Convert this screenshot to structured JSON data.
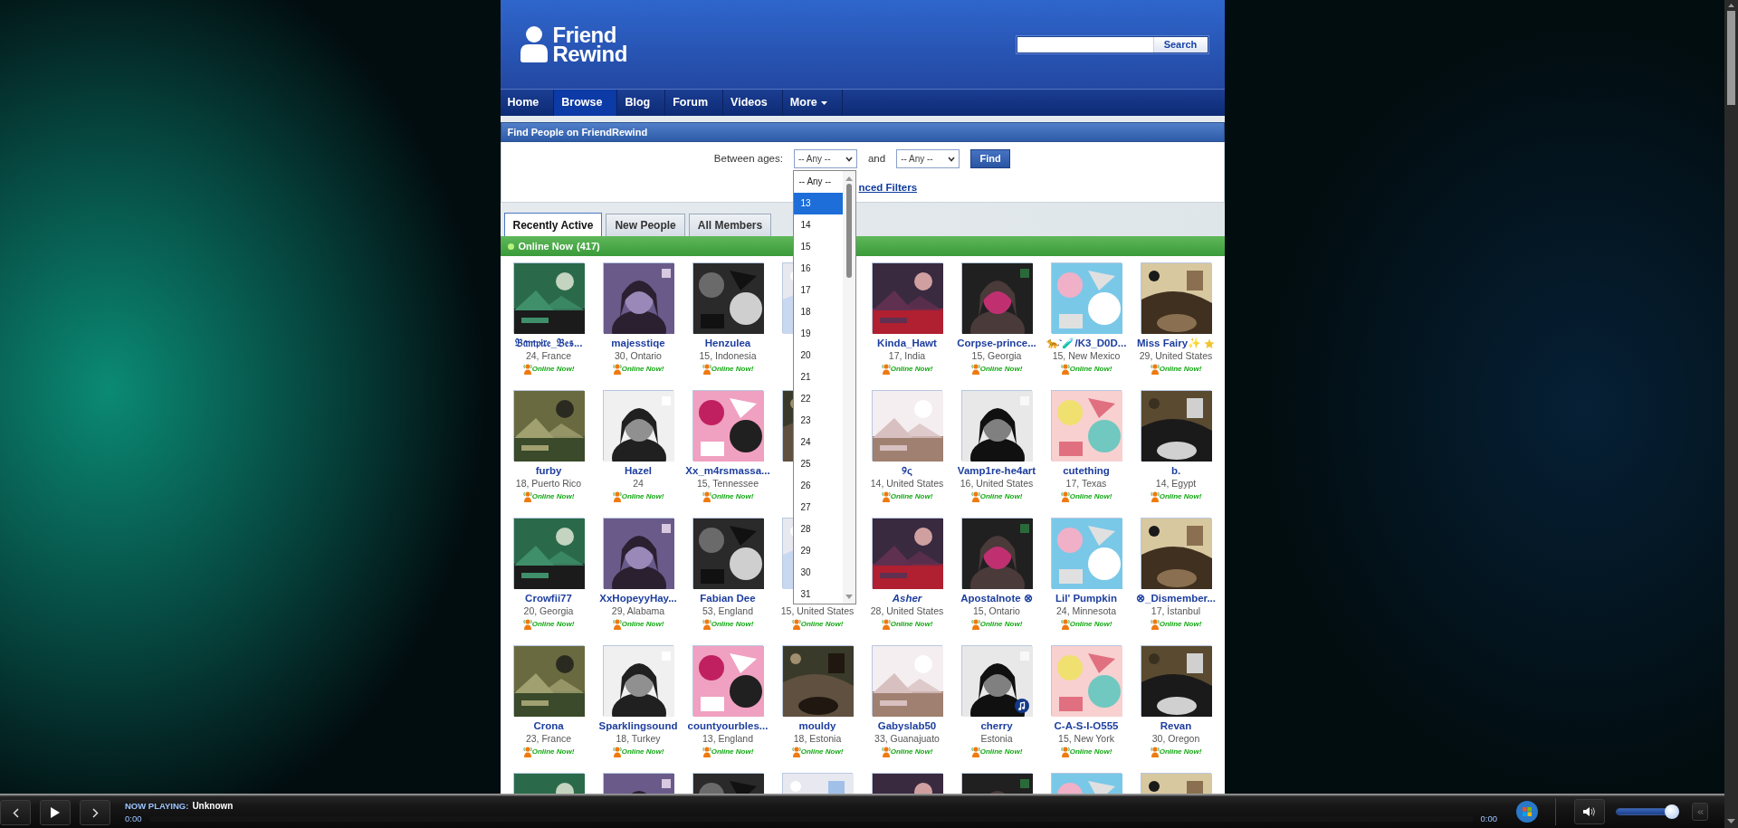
{
  "header": {
    "logo_top": "Friend",
    "logo_bottom": "Rewind",
    "search_button": "Search"
  },
  "nav": [
    {
      "label": "Home",
      "selected": false,
      "menu": false
    },
    {
      "label": "Browse",
      "selected": true,
      "menu": false
    },
    {
      "label": "Blog",
      "selected": false,
      "menu": false
    },
    {
      "label": "Forum",
      "selected": false,
      "menu": false
    },
    {
      "label": "Videos",
      "selected": false,
      "menu": false
    },
    {
      "label": "More",
      "selected": false,
      "menu": true
    }
  ],
  "finder": {
    "title": "Find People on FriendRewind",
    "label": "Between ages:",
    "min_value": "-- Any --",
    "joiner": "and",
    "max_value": "-- Any --",
    "button": "Find",
    "link": "nced Filters"
  },
  "age_dropdown": {
    "options": [
      {
        "label": "-- Any --",
        "selected": false
      },
      {
        "label": "13",
        "selected": true
      },
      {
        "label": "14",
        "selected": false
      },
      {
        "label": "15",
        "selected": false
      },
      {
        "label": "16",
        "selected": false
      },
      {
        "label": "17",
        "selected": false
      },
      {
        "label": "18",
        "selected": false
      },
      {
        "label": "19",
        "selected": false
      },
      {
        "label": "20",
        "selected": false
      },
      {
        "label": "21",
        "selected": false
      },
      {
        "label": "22",
        "selected": false
      },
      {
        "label": "23",
        "selected": false
      },
      {
        "label": "24",
        "selected": false
      },
      {
        "label": "25",
        "selected": false
      },
      {
        "label": "26",
        "selected": false
      },
      {
        "label": "27",
        "selected": false
      },
      {
        "label": "28",
        "selected": false
      },
      {
        "label": "29",
        "selected": false
      },
      {
        "label": "30",
        "selected": false
      },
      {
        "label": "31",
        "selected": false
      }
    ]
  },
  "tabs": [
    {
      "label": "Recently Active",
      "selected": true
    },
    {
      "label": "New People",
      "selected": false
    },
    {
      "label": "All Members",
      "selected": false
    }
  ],
  "online_bar": {
    "label": "Online Now",
    "count": "(417)"
  },
  "members": [
    {
      "kind": "member",
      "name": "𝔅𝔞𝔪𝔭𝔦𝔯𝔢_𝔅𝔢𝔰...",
      "info": "24, France",
      "status": "Online Now!"
    },
    {
      "kind": "member",
      "name": "majesstiqe",
      "info": "30, Ontario",
      "status": "Online Now!"
    },
    {
      "kind": "member",
      "name": "Henzulea",
      "info": "15, Indonesia",
      "status": "Online Now!"
    },
    {
      "kind": "picture"
    },
    {
      "kind": "member",
      "name": "Kinda_Hawt",
      "info": "17, India",
      "status": "Online Now!"
    },
    {
      "kind": "member",
      "name": "Corpse-prince...",
      "info": "15, Georgia",
      "status": "Online Now!"
    },
    {
      "kind": "member",
      "name": "🐆`🧪/K3_D0D...",
      "info": "15, New Mexico",
      "status": "Online Now!"
    },
    {
      "kind": "member",
      "name": "Miss Fairy✨",
      "info": "29, United States",
      "status": "Online Now!",
      "starred": true
    },
    {
      "kind": "member",
      "name": "furby",
      "info": "18, Puerto Rico",
      "status": "Online Now!"
    },
    {
      "kind": "member",
      "name": "Hazel",
      "info": "24",
      "status": "Online Now!"
    },
    {
      "kind": "member",
      "name": "Xx_m4rsmassa...",
      "info": "15, Tennessee",
      "status": "Online Now!"
    },
    {
      "kind": "picture"
    },
    {
      "kind": "member",
      "name": "୨ς",
      "info": "14, United States",
      "status": "Online Now!"
    },
    {
      "kind": "member",
      "name": "Vamp1re-he4art",
      "info": "16, United States",
      "status": "Online Now!"
    },
    {
      "kind": "member",
      "name": "cutething",
      "info": "17, Texas",
      "status": "Online Now!"
    },
    {
      "kind": "member",
      "name": "b.",
      "info": "14, Egypt",
      "status": "Online Now!"
    },
    {
      "kind": "member",
      "name": "Crowfii77",
      "info": "20, Georgia",
      "status": "Online Now!"
    },
    {
      "kind": "member",
      "name": "XxHopeyyHay...",
      "info": "29, Alabama",
      "status": "Online Now!"
    },
    {
      "kind": "member",
      "name": "Fabian Dee",
      "info": "53, England",
      "status": "Online Now!"
    },
    {
      "kind": "member",
      "info": "15, United States",
      "status": "Online Now!"
    },
    {
      "kind": "member",
      "name": "Asher",
      "info": "28, United States",
      "status": "Online Now!",
      "italic": true
    },
    {
      "kind": "member",
      "name": "Apostalnote ⊗",
      "info": "15, Ontario",
      "status": "Online Now!"
    },
    {
      "kind": "member",
      "name": "Lil' Pumpkin",
      "info": "24, Minnesota",
      "status": "Online Now!"
    },
    {
      "kind": "member",
      "name": "⊗_Dismember...",
      "info": "17, İstanbul",
      "status": "Online Now!"
    },
    {
      "kind": "member",
      "name": "Crona",
      "info": "23, France",
      "status": "Online Now!"
    },
    {
      "kind": "member",
      "name": "Sparklingsound",
      "info": "18, Turkey",
      "status": "Online Now!"
    },
    {
      "kind": "member",
      "name": "countyourbles...",
      "info": "13, England",
      "status": "Online Now!"
    },
    {
      "kind": "member",
      "name": "mouldy",
      "info": "18, Estonia",
      "status": "Online Now!"
    },
    {
      "kind": "member",
      "name": "Gabyslab50",
      "info": "33, Guanajuato",
      "status": "Online Now!"
    },
    {
      "kind": "member",
      "name": "cherry",
      "info": "Estonia",
      "status": "Online Now!",
      "music_badge": true
    },
    {
      "kind": "member",
      "name": "C-A-S-I-O555",
      "info": "15, New York",
      "status": "Online Now!"
    },
    {
      "kind": "member",
      "name": "Revan",
      "info": "30, Oregon",
      "status": "Online Now!"
    },
    {
      "kind": "picture"
    },
    {
      "kind": "picture"
    },
    {
      "kind": "picture"
    },
    {
      "kind": "picture"
    },
    {
      "kind": "picture"
    },
    {
      "kind": "picture"
    },
    {
      "kind": "picture"
    },
    {
      "kind": "picture"
    }
  ],
  "player": {
    "label": "NOW PLAYING:",
    "track": "Unknown",
    "elapsed": "0:00",
    "duration": "0:00",
    "volume": {
      "level": 0.92
    }
  }
}
